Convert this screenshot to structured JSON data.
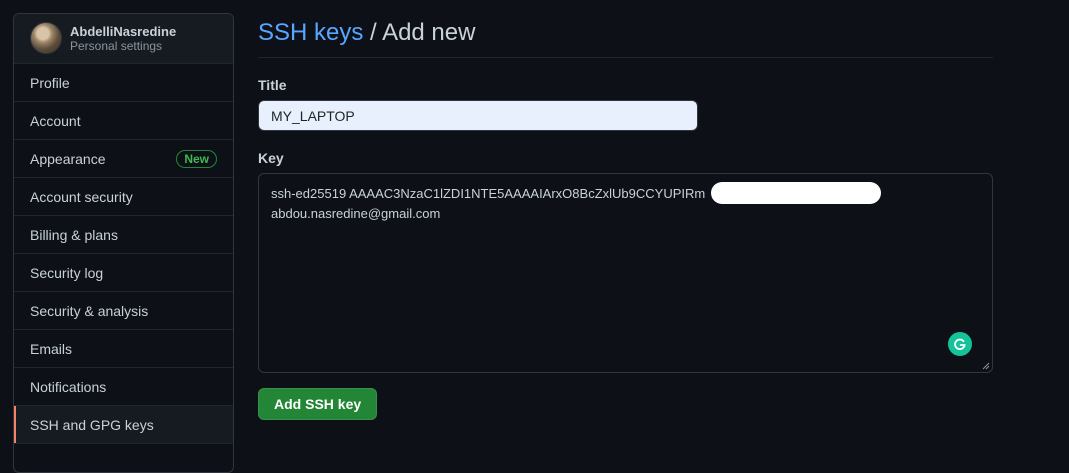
{
  "sidebar": {
    "profile": {
      "name": "AbdelliNasredine",
      "subtitle": "Personal settings"
    },
    "items": [
      {
        "label": "Profile"
      },
      {
        "label": "Account"
      },
      {
        "label": "Appearance",
        "badge": "New"
      },
      {
        "label": "Account security"
      },
      {
        "label": "Billing & plans"
      },
      {
        "label": "Security log"
      },
      {
        "label": "Security & analysis"
      },
      {
        "label": "Emails"
      },
      {
        "label": "Notifications"
      },
      {
        "label": "SSH and GPG keys",
        "active": true
      }
    ]
  },
  "main": {
    "breadcrumb": {
      "link": "SSH keys",
      "separator": " / ",
      "current": "Add new"
    },
    "title_field": {
      "label": "Title",
      "value": "MY_LAPTOP"
    },
    "key_field": {
      "label": "Key",
      "line1": "ssh-ed25519 AAAAC3NzaC1lZDI1NTE5AAAAIArxO8BcZxlUb9CCYUPIRm",
      "line2": "abdou.nasredine@gmail.com"
    },
    "submit_label": "Add SSH key"
  },
  "colors": {
    "background": "#0d1117",
    "link": "#58a6ff",
    "primary_button": "#238636",
    "active_indicator": "#f78166",
    "badge_green": "#3fb950",
    "grammarly": "#15c39a"
  },
  "icons": {
    "grammarly": "grammarly-icon",
    "avatar": "avatar"
  }
}
